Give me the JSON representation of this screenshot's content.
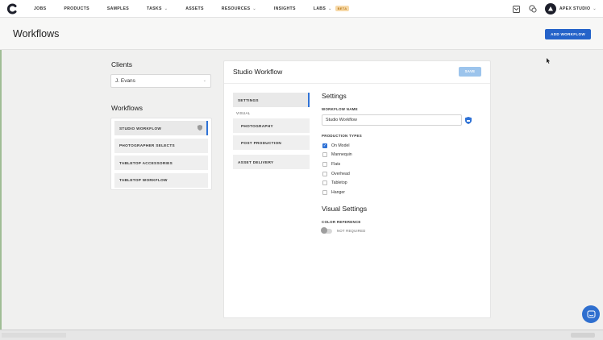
{
  "nav": {
    "items": [
      {
        "label": "JOBS",
        "has_chevron": false
      },
      {
        "label": "PRODUCTS",
        "has_chevron": false
      },
      {
        "label": "SAMPLES",
        "has_chevron": false
      },
      {
        "label": "TASKS",
        "has_chevron": true
      },
      {
        "label": "ASSETS",
        "has_chevron": false
      },
      {
        "label": "RESOURCES",
        "has_chevron": true
      },
      {
        "label": "INSIGHTS",
        "has_chevron": false
      },
      {
        "label": "LABS",
        "has_chevron": true
      }
    ],
    "labs_badge": "BETA",
    "studio_name": "APEX STUDIO",
    "icons": [
      "logo-c-icon",
      "inbox-icon",
      "support-icon",
      "avatar"
    ]
  },
  "header": {
    "title": "Workflows",
    "add_button": "ADD WORKFLOW"
  },
  "sidebar": {
    "clients_label": "Clients",
    "client_value": "J. Evans",
    "workflows_label": "Workflows",
    "workflows": [
      {
        "label": "STUDIO WORKFLOW",
        "active": true
      },
      {
        "label": "PHOTOGRAPHER SELECTS",
        "active": false
      },
      {
        "label": "TABLETOP ACCESSORIES",
        "active": false
      },
      {
        "label": "TABLETOP WORKFLOW",
        "active": false
      }
    ]
  },
  "card": {
    "title": "Studio Workflow",
    "save_label": "SAVE",
    "tabs": {
      "settings": "SETTINGS",
      "visual_section": "VISUAL",
      "photography": "PHOTOGRAPHY",
      "post_production": "POST PRODUCTION",
      "asset_delivery": "ASSET DELIVERY"
    },
    "settings": {
      "heading": "Settings",
      "name_label": "WORKFLOW NAME",
      "name_value": "Studio Workflow",
      "production_label": "PRODUCTION TYPES",
      "production_types": [
        {
          "label": "On Model",
          "checked": true
        },
        {
          "label": "Mannequin",
          "checked": false
        },
        {
          "label": "Flats",
          "checked": false
        },
        {
          "label": "Overhead",
          "checked": false
        },
        {
          "label": "Tabletop",
          "checked": false
        },
        {
          "label": "Hanger",
          "checked": false
        }
      ],
      "visual_heading": "Visual Settings",
      "color_ref_label": "COLOR REFERENCE",
      "color_ref_toggle": "NOT REQUIRED"
    }
  },
  "colors": {
    "accent": "#2563c9",
    "save_disabled": "#9cc4ec",
    "beta_bg": "#f7d9a8"
  }
}
